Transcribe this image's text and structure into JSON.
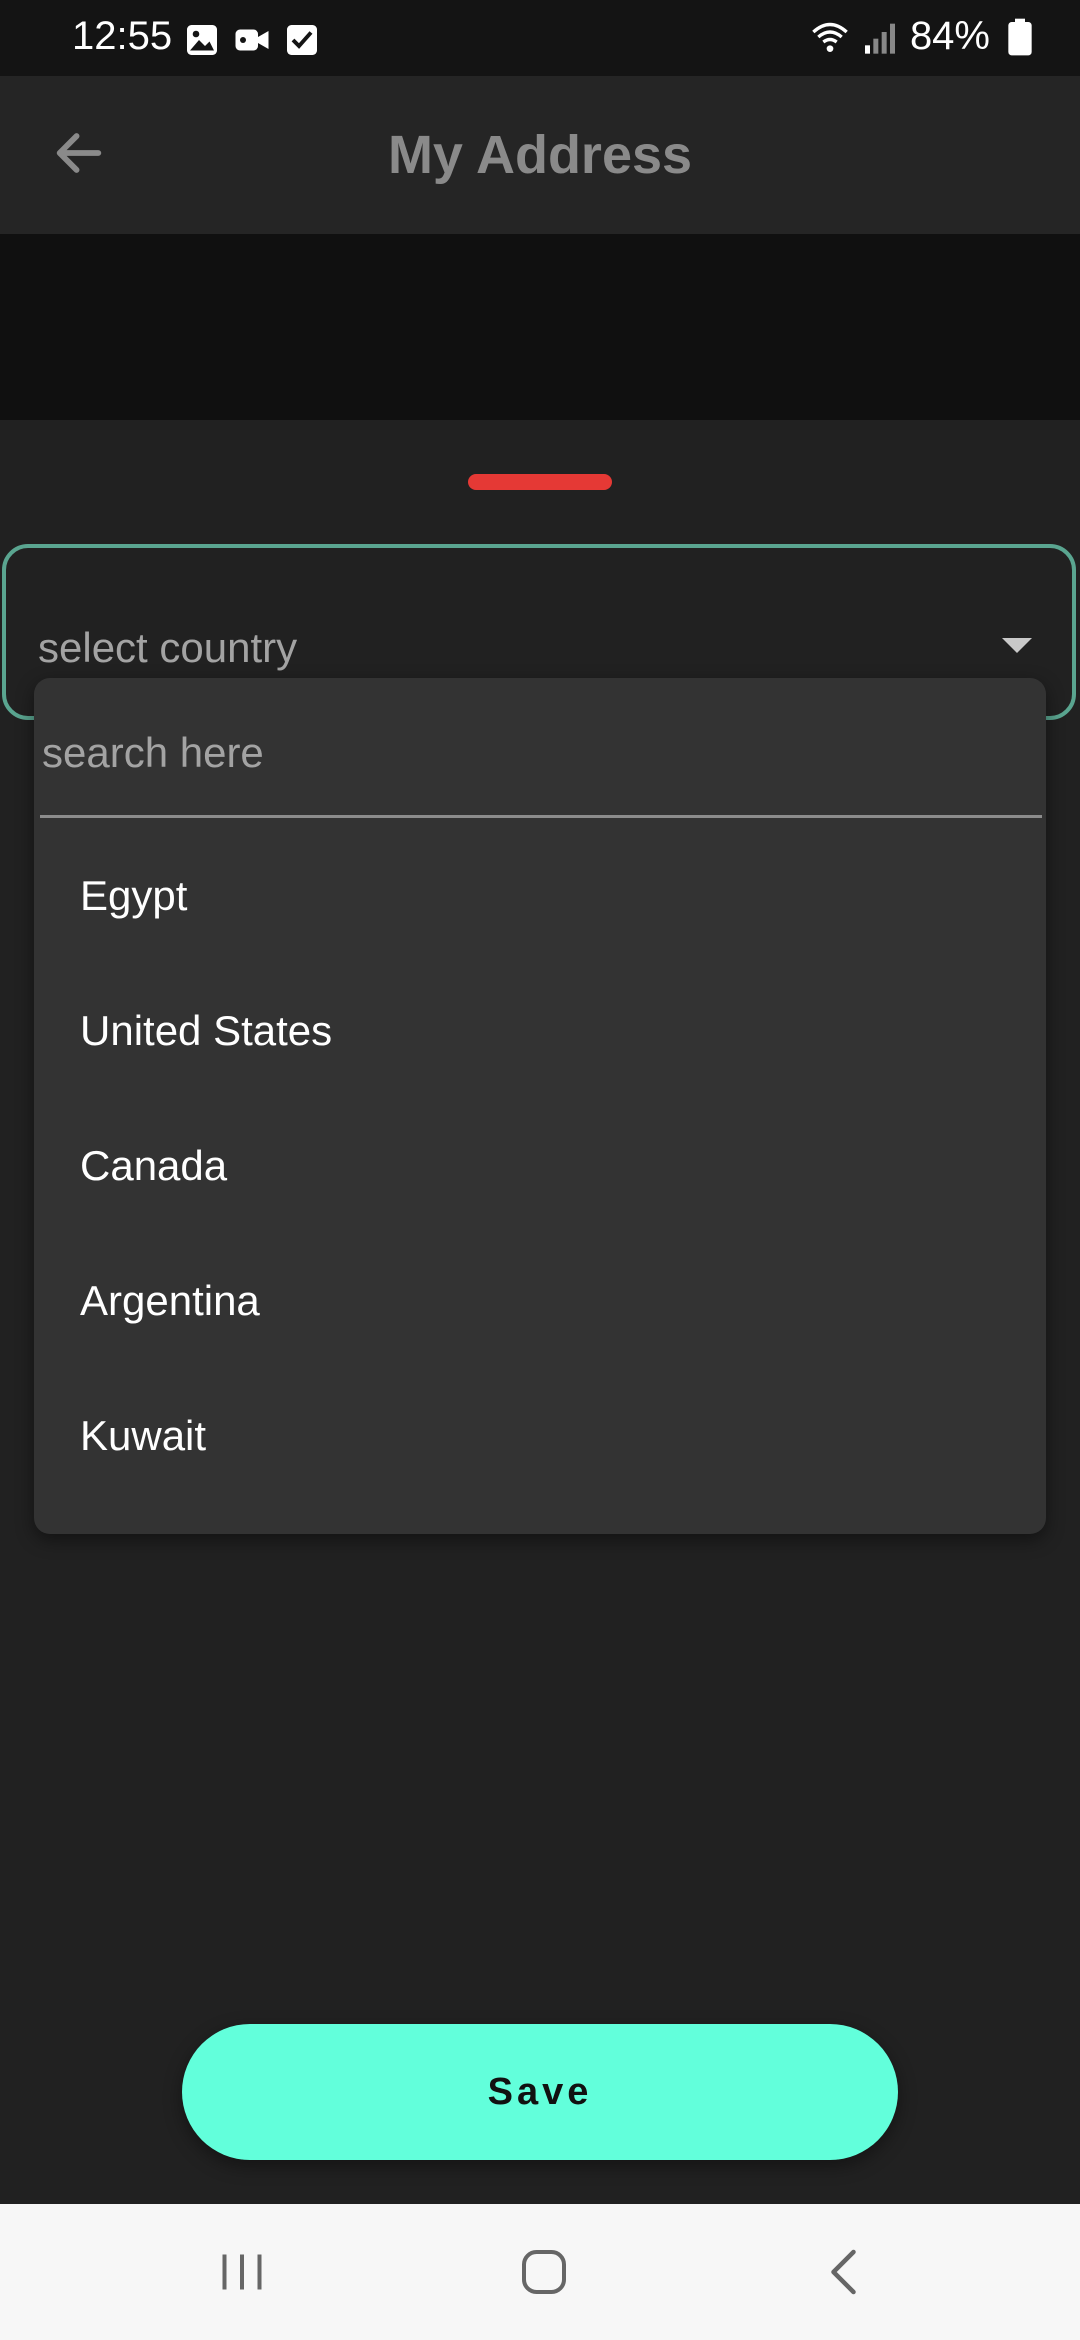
{
  "status_bar": {
    "time": "12:55",
    "battery": "84%",
    "left_icons": [
      "gallery-icon",
      "video-icon",
      "checkbox-icon"
    ],
    "right_icons": [
      "wifi-icon",
      "signal-icon",
      "battery-icon"
    ]
  },
  "app_bar": {
    "title": "My Address",
    "back_icon": "arrow-left-icon"
  },
  "sheet": {
    "handle_color": "#e53935",
    "country_field": {
      "placeholder": "select country",
      "border_color": "#5aa590"
    },
    "dropdown": {
      "search_placeholder": "search here",
      "items": [
        "Egypt",
        "United States",
        "Canada",
        "Argentina",
        "Kuwait"
      ]
    }
  },
  "save": {
    "label": "Save",
    "color": "#62ffdb"
  },
  "nav_bar": {
    "buttons": [
      "recents-icon",
      "home-icon",
      "back-icon"
    ]
  }
}
